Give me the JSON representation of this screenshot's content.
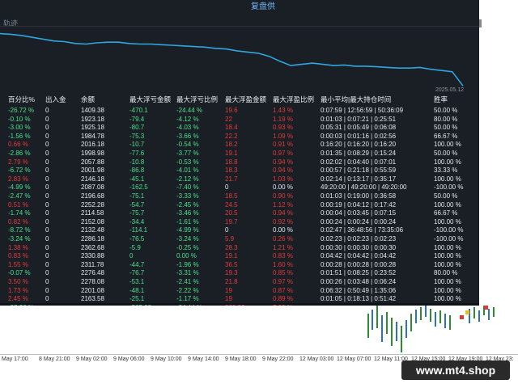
{
  "panel": {
    "title": "复盘供",
    "curve_label": "轨迹",
    "curve_date": "2025.05.12",
    "curve_values": [
      0.1,
      0.11,
      0.13,
      0.16,
      0.19,
      0.22,
      0.23,
      0.26,
      0.27,
      0.25,
      0.24,
      0.24,
      0.26,
      0.27,
      0.27,
      0.28,
      0.29,
      0.3,
      0.31,
      0.32,
      0.34,
      0.35,
      0.38,
      0.4,
      0.42,
      0.47,
      0.55,
      0.62,
      0.6,
      0.58,
      0.6,
      0.62,
      0.61,
      0.63,
      0.63,
      0.64,
      0.65,
      0.66,
      0.66,
      0.65,
      0.68,
      0.7,
      0.72,
      0.95
    ]
  },
  "table": {
    "headers": [
      "百分比%",
      "出入金",
      "余额",
      "最大浮亏金额",
      "最大浮亏比例",
      "最大浮盈金额",
      "最大浮盈比例",
      "最小平均|最大持仓时间",
      "胜率"
    ],
    "rows": [
      [
        "-26.72 %",
        "0",
        "1409.38",
        "-470.1",
        "-24.44 %",
        "19.6",
        "1.43 %",
        "0:07:59 | 12:56:59 | 50:36:09",
        "50.00 %"
      ],
      [
        "-0.10 %",
        "0",
        "1923.18",
        "-79.4",
        "-4.12 %",
        "22",
        "1.19 %",
        "0:01:03 | 0:07:21 | 0:25:51",
        "80.00 %"
      ],
      [
        "-3.00 %",
        "0",
        "1925.18",
        "-80.7",
        "-4.03 %",
        "18.4",
        "0.93 %",
        "0:05:31 | 0:05:49 | 0:06:08",
        "50.00 %"
      ],
      [
        "-1.56 %",
        "0",
        "1984.78",
        "-75.3",
        "-3.66 %",
        "22.2",
        "1.09 %",
        "0:00:03 | 0:01:16 | 0:02:56",
        "66.67 %"
      ],
      [
        "0.66 %",
        "0",
        "2016.18",
        "-10.7",
        "-0.54 %",
        "18.2",
        "0.91 %",
        "0:16:20 | 0:16:20 | 0:16:20",
        "100.00 %"
      ],
      [
        "-2.86 %",
        "0",
        "1998.98",
        "-77.6",
        "-3.77 %",
        "19.1",
        "0.97 %",
        "0:01:35 | 0:08:29 | 0:15:24",
        "50.00 %"
      ],
      [
        "2.79 %",
        "0",
        "2057.88",
        "-10.8",
        "-0.53 %",
        "18.8",
        "0.94 %",
        "0:02:02 | 0:04:40 | 0:07:01",
        "100.00 %"
      ],
      [
        "-6.72 %",
        "0",
        "2001.98",
        "-86.8",
        "-4.01 %",
        "18.3",
        "0.94 %",
        "0:00:57 | 0:21:18 | 0:55:59",
        "33.33 %"
      ],
      [
        "2.83 %",
        "0",
        "2146.18",
        "-45.1",
        "-2.12 %",
        "21.7",
        "1.03 %",
        "0:02:14 | 0:13:17 | 0:35:17",
        "100.00 %"
      ],
      [
        "-4.99 %",
        "0",
        "2087.08",
        "-162.5",
        "-7.40 %",
        "0",
        "0.00 %",
        "49:20:00 | 49:20:00 | 49:20:00",
        "-100.00 %"
      ],
      [
        "-2.47 %",
        "0",
        "2196.68",
        "-75.1",
        "-3.33 %",
        "18.5",
        "0.90 %",
        "0:01:03 | 0:19:00 | 0:36:58",
        "50.00 %"
      ],
      [
        "0.51 %",
        "0",
        "2252.28",
        "-54.7",
        "-2.45 %",
        "24.5",
        "1.12 %",
        "0:00:19 | 0:04:12 | 0:17:42",
        "100.00 %"
      ],
      [
        "-1.74 %",
        "0",
        "2114.58",
        "-75.7",
        "-3.46 %",
        "20.5",
        "0.94 %",
        "0:00:04 | 0:03:45 | 0:07:15",
        "66.67 %"
      ],
      [
        "0.82 %",
        "0",
        "2152.08",
        "-34.4",
        "-1.61 %",
        "19.7",
        "0.92 %",
        "0:00:24 | 0:00:24 | 0:00:24",
        "100.00 %"
      ],
      [
        "-8.72 %",
        "0",
        "2132.48",
        "-114.1",
        "-4.99 %",
        "0",
        "0.00 %",
        "0:02:47 | 36:48:56 | 73:35:06",
        "-100.00 %"
      ],
      [
        "-3.24 %",
        "0",
        "2286.18",
        "-76.5",
        "-3.24 %",
        "5.9",
        "0.26 %",
        "0:02:23 | 0:02:23 | 0:02:23",
        "-100.00 %"
      ],
      [
        "1.38 %",
        "0",
        "2362.68",
        "-5.9",
        "-0.25 %",
        "28.3",
        "1.21 %",
        "0:00:30 | 0:00:30 | 0:00:30",
        "100.00 %"
      ],
      [
        "0.83 %",
        "0",
        "2330.88",
        "0",
        "0.00 %",
        "19.1",
        "0.83 %",
        "0:04:42 | 0:04:42 | 0:04:42",
        "100.00 %"
      ],
      [
        "1.55 %",
        "0",
        "2311.78",
        "-44.7",
        "-1.96 %",
        "36.5",
        "1.60 %",
        "0:00:28 | 0:00:28 | 0:00:28",
        "100.00 %"
      ],
      [
        "-0.07 %",
        "0",
        "2276.48",
        "-76.7",
        "-3.31 %",
        "19.3",
        "0.85 %",
        "0:01:51 | 0:08:25 | 0:23:52",
        "80.00 %"
      ],
      [
        "3.50 %",
        "0",
        "2278.08",
        "-53.1",
        "-2.41 %",
        "21.8",
        "0.97 %",
        "0:00:26 | 0:03:48 | 0:06:24",
        "100.00 %"
      ],
      [
        "1.73 %",
        "0",
        "2201.08",
        "-48.1",
        "-2.22 %",
        "19",
        "0.87 %",
        "0:06:32 | 0:50:49 | 1:35:06",
        "100.00 %"
      ],
      [
        "2.45 %",
        "0",
        "2163.58",
        "-25.1",
        "-1.17 %",
        "19",
        "0.89 %",
        "0:01:05 | 0:18:13 | 0:51:42",
        "100.00 %"
      ]
    ],
    "total": [
      "-33.26 %",
      "",
      "",
      "-565.08",
      "-24.44 %",
      "220.32",
      "7.99 %",
      "",
      ""
    ]
  },
  "xaxis": {
    "labels": [
      "May 17:00",
      "8 May 21:00",
      "9 May 02:00",
      "9 May 06:00",
      "9 May 10:00",
      "9 May 14:00",
      "9 May 18:00",
      "9 May 22:00",
      "12 May 03:00",
      "12 May 07:00",
      "12 May 11:00",
      "12 May 15:00",
      "12 May 19:00",
      "12 May 23:"
    ]
  },
  "watermark": {
    "text": "www.mt4.shop"
  },
  "colors": {
    "panel_bg": "#1a1f26",
    "curve": "#2fa6e0",
    "positive": "#49e08b",
    "negative": "#e23b3b",
    "title": "#6fb6ff"
  }
}
